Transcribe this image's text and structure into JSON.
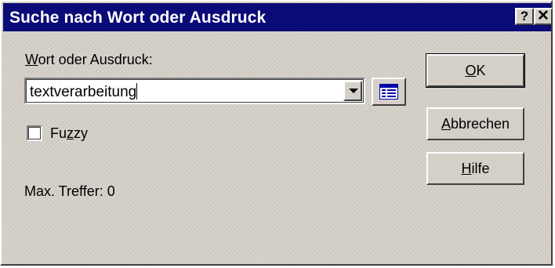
{
  "window": {
    "title": "Suche nach Wort oder Ausdruck",
    "help_glyph": "?",
    "close_glyph": "✕"
  },
  "search": {
    "label_first": "W",
    "label_rest": "ort oder Ausdruck:",
    "value": "textverarbeitung"
  },
  "fuzzy": {
    "label_a": "Fu",
    "label_b": "z",
    "label_c": "zy",
    "checked": false
  },
  "status": {
    "max_hits": "Max. Treffer: 0"
  },
  "buttons": {
    "ok_first": "O",
    "ok_rest": "K",
    "cancel_first": "A",
    "cancel_rest": "bbrechen",
    "help_first": "H",
    "help_rest": "ilfe"
  },
  "colors": {
    "titlebar": "#0a0a78",
    "face": "#d4d0c8",
    "list_icon": "#0000a8"
  },
  "icons": {
    "help": "question-mark-icon",
    "close": "close-icon",
    "dropdown": "chevron-down-icon",
    "list": "list-icon"
  }
}
